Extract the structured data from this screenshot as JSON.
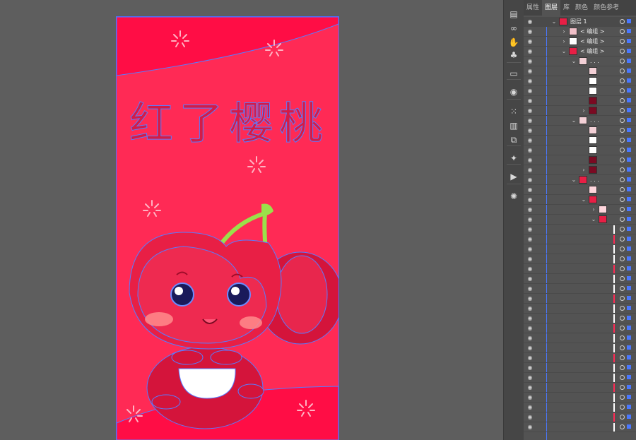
{
  "artwork": {
    "title_text": "红了樱桃"
  },
  "panel": {
    "tabs": [
      {
        "label": "属性",
        "active": false
      },
      {
        "label": "图层",
        "active": true
      },
      {
        "label": "库",
        "active": false
      },
      {
        "label": "颜色",
        "active": false
      },
      {
        "label": "颜色参考",
        "active": false
      }
    ],
    "layers": [
      {
        "name": "图层 1",
        "level": 0,
        "chevron": "v",
        "thumb": "layer",
        "selected": true
      },
      {
        "name": "< 编组 >",
        "level": 1,
        "chevron": ">",
        "thumb": "group"
      },
      {
        "name": "< 编组 >",
        "level": 1,
        "chevron": ">",
        "thumb": "white"
      },
      {
        "name": "< 编组 >",
        "level": 1,
        "chevron": "v",
        "thumb": "cherry"
      },
      {
        "name": ". . .",
        "level": 2,
        "chevron": "v",
        "thumb": "mixed"
      },
      {
        "name": "",
        "level": 3,
        "chevron": "",
        "thumb": "mixed"
      },
      {
        "name": "",
        "level": 3,
        "chevron": "",
        "thumb": "white"
      },
      {
        "name": "",
        "level": 3,
        "chevron": "",
        "thumb": "white"
      },
      {
        "name": "",
        "level": 3,
        "chevron": "",
        "thumb": "dark"
      },
      {
        "name": "",
        "level": 3,
        "chevron": ">",
        "thumb": "dark"
      },
      {
        "name": ". . .",
        "level": 2,
        "chevron": "v",
        "thumb": "mixed"
      },
      {
        "name": "",
        "level": 3,
        "chevron": "",
        "thumb": "mixed"
      },
      {
        "name": "",
        "level": 3,
        "chevron": "",
        "thumb": "white"
      },
      {
        "name": "",
        "level": 3,
        "chevron": "",
        "thumb": "white"
      },
      {
        "name": "",
        "level": 3,
        "chevron": "",
        "thumb": "dark"
      },
      {
        "name": "",
        "level": 3,
        "chevron": ">",
        "thumb": "dark"
      },
      {
        "name": ". . .",
        "level": 2,
        "chevron": "v",
        "thumb": "cherry"
      },
      {
        "name": "",
        "level": 3,
        "chevron": "",
        "thumb": "pink"
      },
      {
        "name": "",
        "level": 3,
        "chevron": "v",
        "thumb": "cherry"
      },
      {
        "name": "",
        "level": 4,
        "chevron": ">",
        "thumb": "pink"
      },
      {
        "name": "",
        "level": 4,
        "chevron": "v",
        "thumb": "cherry"
      }
    ],
    "trailing_rows": 21
  },
  "toolbar": {
    "icons": [
      "properties-icon",
      "links-icon",
      "puppet-warp-icon",
      "club-symbol-icon",
      "gradient-icon",
      "appearance-icon",
      "grid-icon",
      "align-icon",
      "pathfinder-icon",
      "magic-wand-icon",
      "play-icon",
      "sun-icon"
    ]
  },
  "colors": {
    "artboard": "#ff2a55",
    "selection": "#4a78ff",
    "cherry": "#e8163f",
    "stem": "#9be04a"
  }
}
